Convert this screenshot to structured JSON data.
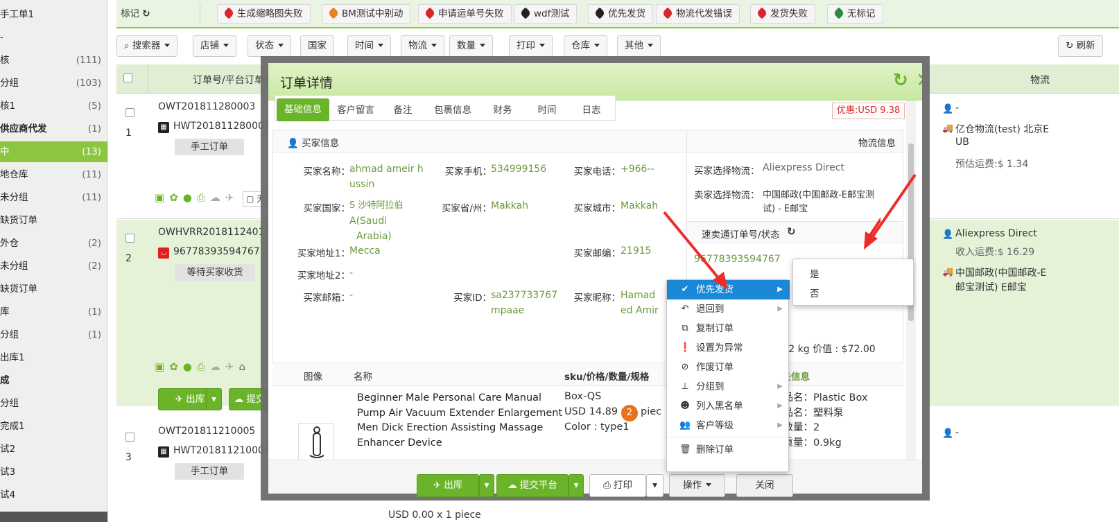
{
  "sidebar": {
    "items": [
      {
        "label": "手工单1",
        "count": ""
      },
      {
        "label": "-",
        "count": ""
      },
      {
        "label": "核",
        "count": "(111)"
      },
      {
        "label": "分组",
        "count": "(103)"
      },
      {
        "label": "核1",
        "count": "(5)"
      },
      {
        "label": "供应商代发",
        "count": "(1)"
      },
      {
        "label": "中",
        "count": "(13)"
      },
      {
        "label": "地仓库",
        "count": "(11)"
      },
      {
        "label": "未分组",
        "count": "(11)"
      },
      {
        "label": "缺货订单",
        "count": ""
      },
      {
        "label": "外仓",
        "count": "(2)"
      },
      {
        "label": "未分组",
        "count": "(2)"
      },
      {
        "label": "缺货订单",
        "count": ""
      },
      {
        "label": "库",
        "count": "(1)"
      },
      {
        "label": "分组",
        "count": "(1)"
      },
      {
        "label": "出库1",
        "count": ""
      },
      {
        "label": "成",
        "count": ""
      },
      {
        "label": "分组",
        "count": ""
      },
      {
        "label": "完成1",
        "count": ""
      },
      {
        "label": "试2",
        "count": ""
      },
      {
        "label": "试3",
        "count": ""
      },
      {
        "label": "试4",
        "count": ""
      }
    ]
  },
  "tagbar": {
    "mark_label": "标记",
    "tags": [
      {
        "label": "生成缩略图失败",
        "color": "#d9262b"
      },
      {
        "label": "BM测试中别动",
        "color": "#e6821e"
      },
      {
        "label": "申请运单号失败",
        "color": "#d9262b"
      },
      {
        "label": "wdf测试",
        "color": "#222222"
      },
      {
        "label": "优先发货",
        "color": "#222222"
      },
      {
        "label": "物流代发错误",
        "color": "#d9262b"
      },
      {
        "label": "发货失败",
        "color": "#d9262b"
      },
      {
        "label": "无标记",
        "color": "#2a8a3a"
      }
    ]
  },
  "filters": [
    "搜索器",
    "店铺",
    "状态",
    "国家",
    "时间",
    "物流",
    "数量",
    "打印",
    "仓库",
    "其他"
  ],
  "refresh_label": "刷新",
  "table": {
    "header_order": "订单号/平台订单号",
    "header_logistics": "物流",
    "rows": [
      {
        "index": "1",
        "order_no": "OWT201811280003",
        "platform_no": "HWT201811280002",
        "badge": "手工订单",
        "buyer_logistics": "-",
        "logistics": "亿仓物流(test) 北京E",
        "logistics2": "UB",
        "fee": "预估运费:$ 1.34"
      },
      {
        "index": "2",
        "order_no": "OWHVRR201811240185",
        "platform_no": "96778393594767",
        "badge": "等待买家收货",
        "buyer_logistics": "Aliexpress Direct",
        "income_fee": "收入运费:$ 16.29",
        "logistics": "中国邮政(中国邮政-E",
        "logistics2": "邮宝测试) E邮宝"
      },
      {
        "index": "3",
        "order_no": "OWT201811210005",
        "platform_no": "HWT201811210004",
        "badge": "手工订单",
        "buyer_logistics": "-"
      }
    ],
    "row2_ship_btn": "出库",
    "row2_submit_btn": "提交",
    "row3_bottom_price": "USD 0.00 x 1 piece",
    "row1_toolbar_extra": "无"
  },
  "modal": {
    "title": "订单详情",
    "tabs": [
      "基础信息",
      "客户留言",
      "备注",
      "包裹信息",
      "财务",
      "时间",
      "日志"
    ],
    "discount": "优惠:USD 9.38",
    "buyer_section": "买家信息",
    "logistics_section": "物流信息",
    "buyer": {
      "name_label": "买家名称：",
      "name": "ahmad ameir h",
      "name2": "ussin",
      "mobile_label": "买家手机：",
      "mobile": "534999156",
      "phone_label": "买家电话：",
      "phone": "+966--",
      "country_label": "买家国家：",
      "country": "S 沙特阿拉伯",
      "country2": "A(Saudi",
      "country3": "Arabia)",
      "province_label": "买家省/州：",
      "province": "Makkah",
      "city_label": "买家城市：",
      "city": "Makkah",
      "addr1_label": "买家地址1：",
      "addr1": "Mecca",
      "zip_label": "买家邮编：",
      "zip": "21915",
      "addr2_label": "买家地址2：",
      "addr2": "-",
      "email_label": "买家邮箱：",
      "email": "-",
      "id_label": "买家ID：",
      "id": "sa237733767",
      "id2": "mpaae",
      "nick_label": "买家昵称：",
      "nick": "Hamad",
      "nick2": "ed Amir"
    },
    "logistics": {
      "buyer_choice_label": "买家选择物流：",
      "buyer_choice": "Aliexpress Direct",
      "seller_choice_label": "卖家选择物流：",
      "seller_choice": "中国邮政(中国邮政-E邮宝测",
      "seller_choice2": "试) - E邮宝",
      "tracking_header": "速卖通订单号/状态",
      "tracking_no": "96778393594767",
      "weight_value": "4.62 kg 价值 : $72.00"
    },
    "products": {
      "col_image": "图像",
      "col_name": "名称",
      "col_sku": "sku/价格/数量/规格",
      "col_customs": "报关信息",
      "name_lines": [
        "Beginner Male Personal Care Manual",
        "Pump Air Vacuum Extender Enlargement",
        "Men Dick Erection Assisting Massage",
        "Enhancer Device"
      ],
      "sku": "Box-QS",
      "price": "USD 14.89 x",
      "qty": "2",
      "qty_unit": "piec",
      "spec": "Color : type1",
      "customs": [
        "文品名：Plastic Box",
        "文品名：塑料泵",
        "报数量：2",
        "报重量：0.9kg"
      ]
    },
    "footer": {
      "ship": "出库",
      "submit": "提交平台",
      "print": "打印",
      "ops": "操作",
      "close": "关闭"
    }
  },
  "context_menu": {
    "items": [
      {
        "label": "优先发货",
        "icon": "check-icon",
        "sub": true
      },
      {
        "label": "退回到",
        "icon": "undo-icon",
        "sub": true
      },
      {
        "label": "复制订单",
        "icon": "copy-icon",
        "sub": false
      },
      {
        "label": "设置为异常",
        "icon": "exclamation-icon",
        "sub": false
      },
      {
        "label": "作废订单",
        "icon": "ban-icon",
        "sub": false
      },
      {
        "label": "分组到",
        "icon": "sitemap-icon",
        "sub": true
      },
      {
        "label": "列入黑名单",
        "icon": "blacklist-icon",
        "sub": true
      },
      {
        "label": "客户等级",
        "icon": "users-icon",
        "sub": true
      },
      {
        "label": "删除订单",
        "icon": "trash-icon",
        "sub": false
      }
    ],
    "submenu": [
      "是",
      "否"
    ]
  }
}
